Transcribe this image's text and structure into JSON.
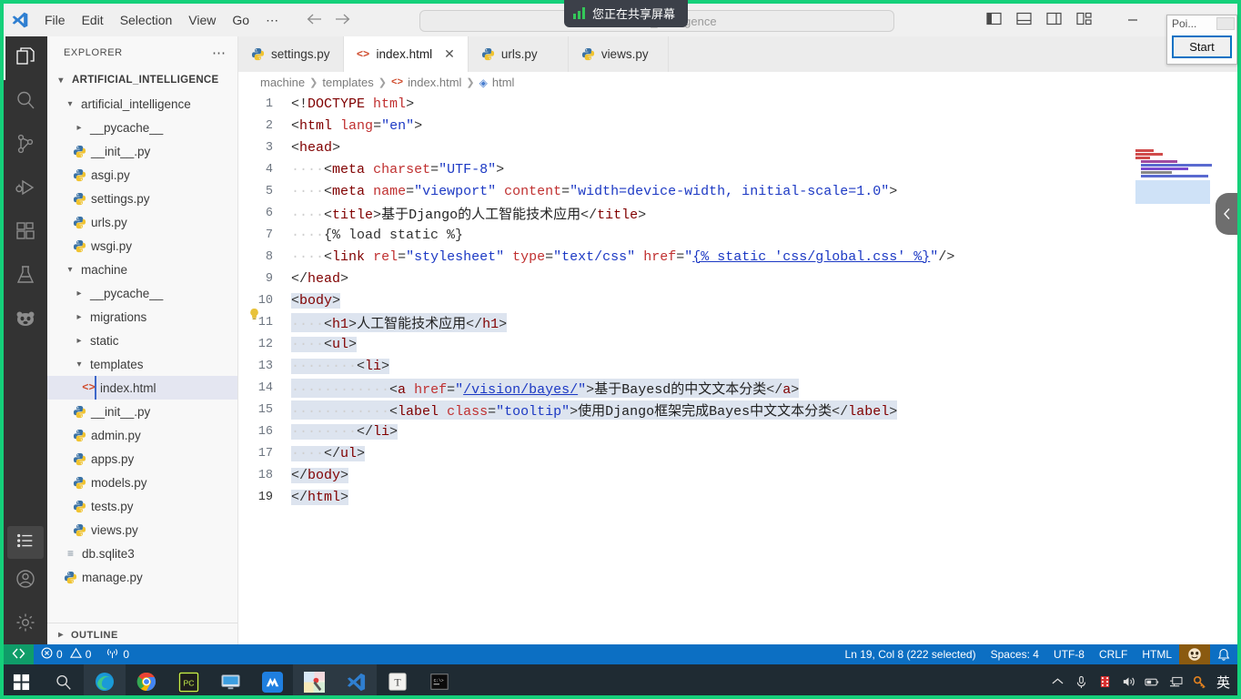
{
  "titlebar": {
    "menu": [
      "File",
      "Edit",
      "Selection",
      "View",
      "Go",
      "⋯"
    ],
    "window_title": "artificial_intelligence",
    "command_center_placeholder": "",
    "back_icon": "arrow-left-icon",
    "forward_icon": "arrow-right-icon"
  },
  "share_toast": {
    "text": "您正在共享屏幕"
  },
  "float_window": {
    "title": "Poi...",
    "start_label": "Start"
  },
  "activitybar": {
    "items": [
      {
        "name": "explorer",
        "icon": "files-icon"
      },
      {
        "name": "search",
        "icon": "search-icon"
      },
      {
        "name": "source-control",
        "icon": "source-control-icon"
      },
      {
        "name": "run-debug",
        "icon": "run-debug-icon"
      },
      {
        "name": "extensions",
        "icon": "extensions-icon"
      },
      {
        "name": "testing",
        "icon": "beaker-icon"
      },
      {
        "name": "panda-extension",
        "icon": "panda-icon"
      },
      {
        "name": "task-list",
        "icon": "list-icon"
      },
      {
        "name": "accounts",
        "icon": "account-icon"
      },
      {
        "name": "manage-settings",
        "icon": "gear-icon"
      }
    ]
  },
  "sidebar": {
    "header": "EXPLORER",
    "root": "ARTIFICIAL_INTELLIGENCE",
    "outline": "OUTLINE",
    "tree": [
      {
        "label": "artificial_intelligence",
        "type": "folder",
        "open": true,
        "depth": 1
      },
      {
        "label": "__pycache__",
        "type": "folder",
        "open": false,
        "depth": 2
      },
      {
        "label": "__init__.py",
        "type": "py",
        "depth": 2
      },
      {
        "label": "asgi.py",
        "type": "py",
        "depth": 2
      },
      {
        "label": "settings.py",
        "type": "py",
        "depth": 2
      },
      {
        "label": "urls.py",
        "type": "py",
        "depth": 2
      },
      {
        "label": "wsgi.py",
        "type": "py",
        "depth": 2
      },
      {
        "label": "machine",
        "type": "folder",
        "open": true,
        "depth": 1
      },
      {
        "label": "__pycache__",
        "type": "folder",
        "open": false,
        "depth": 2
      },
      {
        "label": "migrations",
        "type": "folder",
        "open": false,
        "depth": 2
      },
      {
        "label": "static",
        "type": "folder",
        "open": false,
        "depth": 2
      },
      {
        "label": "templates",
        "type": "folder",
        "open": true,
        "depth": 2
      },
      {
        "label": "index.html",
        "type": "html",
        "depth": 3,
        "selected": true
      },
      {
        "label": "__init__.py",
        "type": "py",
        "depth": 2
      },
      {
        "label": "admin.py",
        "type": "py",
        "depth": 2
      },
      {
        "label": "apps.py",
        "type": "py",
        "depth": 2
      },
      {
        "label": "models.py",
        "type": "py",
        "depth": 2
      },
      {
        "label": "tests.py",
        "type": "py",
        "depth": 2
      },
      {
        "label": "views.py",
        "type": "py",
        "depth": 2
      },
      {
        "label": "db.sqlite3",
        "type": "db",
        "depth": 1
      },
      {
        "label": "manage.py",
        "type": "py",
        "depth": 1
      }
    ]
  },
  "editor": {
    "tabs": [
      {
        "label": "settings.py",
        "type": "py",
        "active": false,
        "closable": false
      },
      {
        "label": "index.html",
        "type": "html",
        "active": true,
        "closable": true,
        "close_icon": "close-icon"
      },
      {
        "label": "urls.py",
        "type": "py",
        "active": false,
        "closable": false
      },
      {
        "label": "views.py",
        "type": "py",
        "active": false,
        "closable": false
      }
    ],
    "breadcrumb": [
      "machine",
      "templates",
      "index.html",
      "html"
    ],
    "quickfix_icon": "lightbulb-icon",
    "lines": [
      {
        "n": 1,
        "sel": false,
        "html": "<span class='punct'>&lt;!</span><span class='tag'>DOCTYPE</span> <span class='attr'>html</span><span class='punct'>&gt;</span>"
      },
      {
        "n": 2,
        "sel": false,
        "html": "<span class='punct'>&lt;</span><span class='tag'>html</span> <span class='attr'>lang</span><span class='punct'>=</span><span class='val'>\"en\"</span><span class='punct'>&gt;</span>"
      },
      {
        "n": 3,
        "sel": false,
        "html": "<span class='punct'>&lt;</span><span class='tag'>head</span><span class='punct'>&gt;</span>"
      },
      {
        "n": 4,
        "sel": false,
        "html": "<span class='dots'>····</span><span class='punct'>&lt;</span><span class='tag'>meta</span> <span class='attr'>charset</span><span class='punct'>=</span><span class='val'>\"UTF-8\"</span><span class='punct'>&gt;</span>"
      },
      {
        "n": 5,
        "sel": false,
        "html": "<span class='dots'>····</span><span class='punct'>&lt;</span><span class='tag'>meta</span> <span class='attr'>name</span><span class='punct'>=</span><span class='val'>\"viewport\"</span> <span class='attr'>content</span><span class='punct'>=</span><span class='val'>\"width=device-width, initial-scale=1.0\"</span><span class='punct'>&gt;</span>"
      },
      {
        "n": 6,
        "sel": false,
        "html": "<span class='dots'>····</span><span class='punct'>&lt;</span><span class='tag'>title</span><span class='punct'>&gt;</span><span class='txt'>基于Django的人工智能技术应用</span><span class='punct'>&lt;/</span><span class='tag'>title</span><span class='punct'>&gt;</span>"
      },
      {
        "n": 7,
        "sel": false,
        "html": "<span class='dots'>····</span><span class='dj'>{% load static %}</span>"
      },
      {
        "n": 8,
        "sel": false,
        "html": "<span class='dots'>····</span><span class='punct'>&lt;</span><span class='tag'>link</span> <span class='attr'>rel</span><span class='punct'>=</span><span class='val'>\"stylesheet\"</span> <span class='attr'>type</span><span class='punct'>=</span><span class='val'>\"text/css\"</span> <span class='attr'>href</span><span class='punct'>=</span><span class='val'>\"</span><span class='link'>{% static 'css/global.css' %}</span><span class='val'>\"</span><span class='punct'>/&gt;</span>"
      },
      {
        "n": 9,
        "sel": false,
        "html": "<span class='punct'>&lt;/</span><span class='tag'>head</span><span class='punct'>&gt;</span>"
      },
      {
        "n": 10,
        "sel": true,
        "html": "<span class='punct'>&lt;</span><span class='tag'>body</span><span class='punct'>&gt;</span>"
      },
      {
        "n": 11,
        "sel": true,
        "html": "<span class='dots'>····</span><span class='punct'>&lt;</span><span class='tag'>h1</span><span class='punct'>&gt;</span><span class='txt'>人工智能技术应用</span><span class='punct'>&lt;/</span><span class='tag'>h1</span><span class='punct'>&gt;</span>"
      },
      {
        "n": 12,
        "sel": true,
        "html": "<span class='dots'>····</span><span class='punct'>&lt;</span><span class='tag'>ul</span><span class='punct'>&gt;</span>"
      },
      {
        "n": 13,
        "sel": true,
        "html": "<span class='dots'>········</span><span class='punct'>&lt;</span><span class='tag'>li</span><span class='punct'>&gt;</span>"
      },
      {
        "n": 14,
        "sel": true,
        "html": "<span class='dots'>············</span><span class='punct'>&lt;</span><span class='tag'>a</span> <span class='attr'>href</span><span class='punct'>=</span><span class='val'>\"</span><span class='link'>/vision/bayes/</span><span class='val'>\"</span><span class='punct'>&gt;</span><span class='txt'>基于Bayesd的中文文本分类</span><span class='punct'>&lt;/</span><span class='tag'>a</span><span class='punct'>&gt;</span>"
      },
      {
        "n": 15,
        "sel": true,
        "html": "<span class='dots'>············</span><span class='punct'>&lt;</span><span class='tag'>label</span> <span class='attr'>class</span><span class='punct'>=</span><span class='val'>\"tooltip\"</span><span class='punct'>&gt;</span><span class='txt'>使用Django框架完成Bayes中文文本分类</span><span class='punct'>&lt;/</span><span class='tag'>label</span><span class='punct'>&gt;</span>"
      },
      {
        "n": 16,
        "sel": true,
        "html": "<span class='dots'>········</span><span class='punct'>&lt;/</span><span class='tag'>li</span><span class='punct'>&gt;</span>"
      },
      {
        "n": 17,
        "sel": true,
        "html": "<span class='dots'>····</span><span class='punct'>&lt;/</span><span class='tag'>ul</span><span class='punct'>&gt;</span>"
      },
      {
        "n": 18,
        "sel": true,
        "html": "<span class='punct'>&lt;/</span><span class='tag'>body</span><span class='punct'>&gt;</span>"
      },
      {
        "n": 19,
        "sel": true,
        "html": "<span class='punct'>&lt;/</span><span class='tag'>html</span><span class='punct'>&gt;</span>"
      }
    ]
  },
  "statusbar": {
    "remote_icon": "remote-window-icon",
    "errors": "0",
    "warnings": "0",
    "ports": "0",
    "cursor": "Ln 19, Col 8 (222 selected)",
    "indent": "Spaces: 4",
    "encoding": "UTF-8",
    "eol": "CRLF",
    "language": "HTML",
    "smiley_icon": "feedback-icon",
    "bell_icon": "bell-icon",
    "bg": "#0c6fc3"
  },
  "taskbar": {
    "items": [
      {
        "name": "start-button",
        "icon": "windows-icon"
      },
      {
        "name": "search-button",
        "icon": "search-icon"
      },
      {
        "name": "edge",
        "icon": "edge-icon",
        "running": true
      },
      {
        "name": "chrome",
        "icon": "chrome-icon",
        "open": true
      },
      {
        "name": "pycharm",
        "icon": "pycharm-icon",
        "open": true
      },
      {
        "name": "monitor-app",
        "icon": "monitor-icon",
        "open": true
      },
      {
        "name": "m-app",
        "icon": "m-app-icon",
        "open": true
      },
      {
        "name": "paint",
        "icon": "paint-icon",
        "open": true,
        "running": true
      },
      {
        "name": "vscode",
        "icon": "vscode-icon",
        "open": true,
        "running": true
      },
      {
        "name": "t-app",
        "icon": "t-app-icon",
        "open": true
      },
      {
        "name": "terminal",
        "icon": "terminal-icon",
        "open": true
      }
    ],
    "tray": [
      {
        "name": "show-hidden-icons",
        "glyph": "⌃"
      },
      {
        "name": "microphone-icon",
        "glyph": "mic"
      },
      {
        "name": "recorder-icon",
        "glyph": "rec"
      },
      {
        "name": "volume-icon",
        "glyph": "vol"
      },
      {
        "name": "battery-icon",
        "glyph": "bat"
      },
      {
        "name": "network-icon",
        "glyph": "net"
      },
      {
        "name": "key-icon",
        "glyph": "key"
      }
    ],
    "lang": "英"
  },
  "colors": {
    "accent": "#0c6fc3",
    "share_green": "#15d07a",
    "remote_green": "#0f9d69",
    "activity_bg": "#333333",
    "sidebar_bg": "#f8f8f8",
    "selection": "#dde4ef"
  }
}
